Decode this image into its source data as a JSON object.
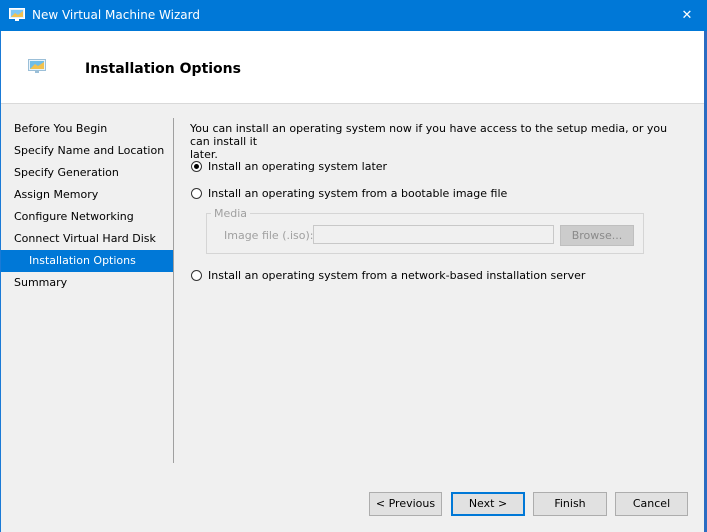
{
  "window": {
    "title": "New Virtual Machine Wizard",
    "accent": "#0078d7",
    "close_glyph": "✕"
  },
  "header": {
    "title": "Installation Options",
    "icon": "virtual-machine-icon"
  },
  "nav": {
    "items": [
      {
        "label": "Before You Begin"
      },
      {
        "label": "Specify Name and Location"
      },
      {
        "label": "Specify Generation"
      },
      {
        "label": "Assign Memory"
      },
      {
        "label": "Configure Networking"
      },
      {
        "label": "Connect Virtual Hard Disk"
      },
      {
        "label": "Installation Options",
        "active": true
      },
      {
        "label": "Summary"
      }
    ]
  },
  "main": {
    "intro_line1": "You can install an operating system now if you have access to the setup media, or you can install it",
    "intro_line2": "later.",
    "options": {
      "later": {
        "label": "Install an operating system later",
        "checked": true
      },
      "image": {
        "label": "Install an operating system from a bootable image file",
        "checked": false
      },
      "network": {
        "label": "Install an operating system from a network-based installation server",
        "checked": false
      }
    },
    "media": {
      "legend": "Media",
      "iso_label": "Image file (.iso):",
      "iso_value": "",
      "browse_label": "Browse..."
    }
  },
  "footer": {
    "previous_label": "< Previous",
    "next_label": "Next >",
    "finish_label": "Finish",
    "cancel_label": "Cancel"
  }
}
